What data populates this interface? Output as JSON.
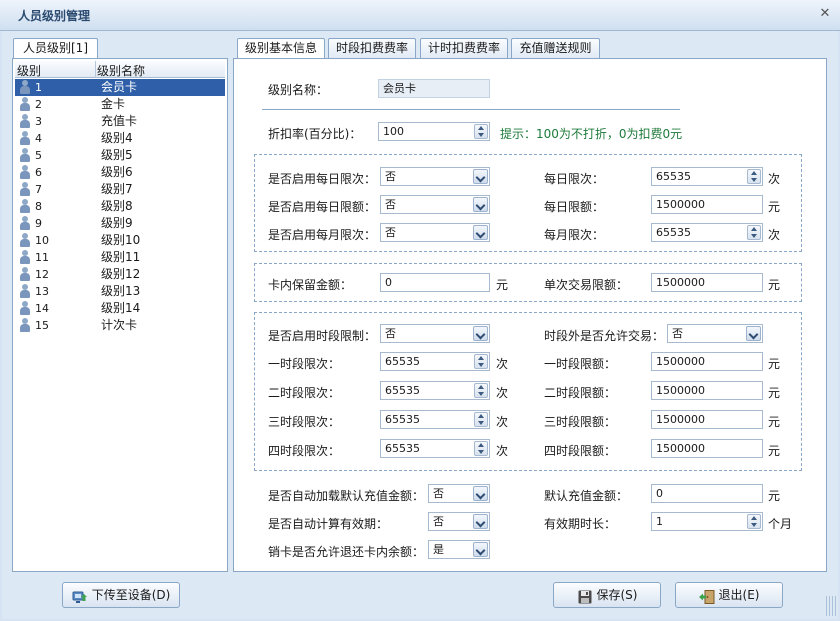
{
  "window": {
    "title": "人员级别管理",
    "close_glyph": "✕"
  },
  "left": {
    "tab": "人员级别[1]",
    "col_level": "级别",
    "col_name": "级别名称",
    "rows": [
      {
        "id": "1",
        "name": "会员卡",
        "selected": true
      },
      {
        "id": "2",
        "name": "金卡"
      },
      {
        "id": "3",
        "name": "充值卡"
      },
      {
        "id": "4",
        "name": "级别4"
      },
      {
        "id": "5",
        "name": "级别5"
      },
      {
        "id": "6",
        "name": "级别6"
      },
      {
        "id": "7",
        "name": "级别7"
      },
      {
        "id": "8",
        "name": "级别8"
      },
      {
        "id": "9",
        "name": "级别9"
      },
      {
        "id": "10",
        "name": "级别10"
      },
      {
        "id": "11",
        "name": "级别11"
      },
      {
        "id": "12",
        "name": "级别12"
      },
      {
        "id": "13",
        "name": "级别13"
      },
      {
        "id": "14",
        "name": "级别14"
      },
      {
        "id": "15",
        "name": "计次卡"
      }
    ]
  },
  "tabs": [
    "级别基本信息",
    "时段扣费费率",
    "计时扣费费率",
    "充值赠送规则"
  ],
  "form": {
    "level_name_label": "级别名称：",
    "level_name_value": "会员卡",
    "discount_label": "折扣率(百分比)：",
    "discount_value": "100",
    "hint": "提示：100为不打折，0为扣费0元",
    "daily_count_enable_label": "是否启用每日限次：",
    "daily_count_enable_value": "否",
    "daily_amount_enable_label": "是否启用每日限额：",
    "daily_amount_enable_value": "否",
    "monthly_count_enable_label": "是否启用每月限次：",
    "monthly_count_enable_value": "否",
    "daily_count_label": "每日限次：",
    "daily_count_value": "65535",
    "daily_amount_label": "每日限额：",
    "daily_amount_value": "1500000",
    "monthly_count_label": "每月限次：",
    "monthly_count_value": "65535",
    "reserve_label": "卡内保留金额：",
    "reserve_value": "0",
    "single_limit_label": "单次交易限额：",
    "single_limit_value": "1500000",
    "period_enable_label": "是否启用时段限制：",
    "period_enable_value": "否",
    "outside_period_label": "时段外是否允许交易：",
    "outside_period_value": "否",
    "periods": [
      {
        "count_label": "一时段限次：",
        "count_value": "65535",
        "amount_label": "一时段限额：",
        "amount_value": "1500000"
      },
      {
        "count_label": "二时段限次：",
        "count_value": "65535",
        "amount_label": "二时段限额：",
        "amount_value": "1500000"
      },
      {
        "count_label": "三时段限次：",
        "count_value": "65535",
        "amount_label": "三时段限额：",
        "amount_value": "1500000"
      },
      {
        "count_label": "四时段限次：",
        "count_value": "65535",
        "amount_label": "四时段限额：",
        "amount_value": "1500000"
      }
    ],
    "auto_load_label": "是否自动加载默认充值金额：",
    "auto_load_value": "否",
    "default_recharge_label": "默认充值金额：",
    "default_recharge_value": "0",
    "auto_validity_label": "是否自动计算有效期：",
    "auto_validity_value": "否",
    "validity_label": "有效期时长：",
    "validity_value": "1",
    "refund_label": "销卡是否允许退还卡内余额：",
    "refund_value": "是"
  },
  "units": {
    "times": "次",
    "yuan": "元",
    "months": "个月"
  },
  "buttons": {
    "upload": "下传至设备(D)",
    "save": "保存(S)",
    "exit": "退出(E)"
  }
}
